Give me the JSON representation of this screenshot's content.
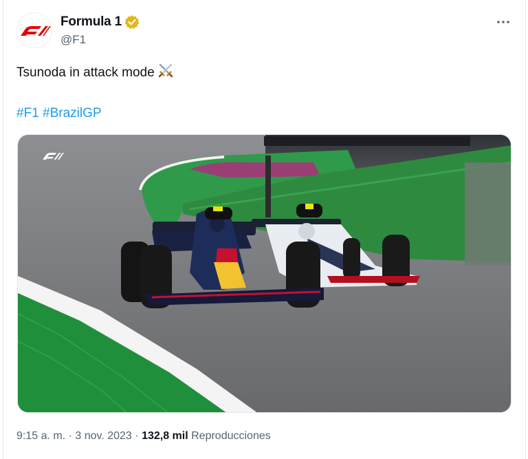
{
  "author": {
    "display_name": "Formula 1",
    "handle": "@F1",
    "verified_color": "#e2b719"
  },
  "tweet": {
    "text": "Tsunoda in attack mode",
    "emoji_icon": "crossed-swords-icon",
    "hashtags": [
      "#F1",
      "#BrazilGP"
    ]
  },
  "media": {
    "watermark_icon": "f1-logo-icon"
  },
  "meta": {
    "time": "9:15 a. m.",
    "separator": "·",
    "date": "3 nov. 2023",
    "views_count": "132,8 mil",
    "views_label": "Reproducciones"
  },
  "colors": {
    "brand_red": "#e10600",
    "link_blue": "#1d9bf0",
    "muted_text": "#536471"
  }
}
